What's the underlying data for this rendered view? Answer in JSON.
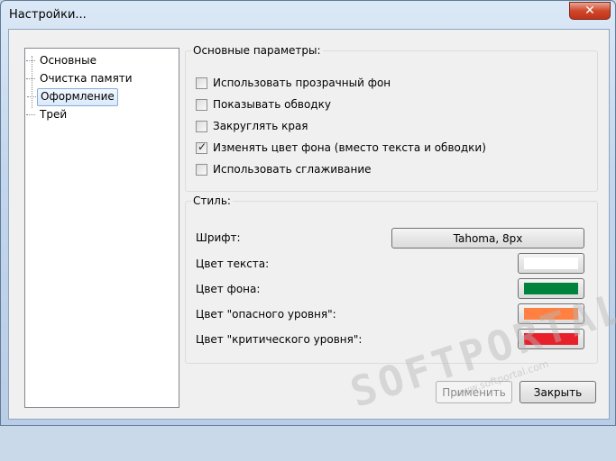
{
  "window": {
    "title": "Настройки...",
    "close_glyph": "✕"
  },
  "tree": {
    "items": [
      {
        "label": "Основные",
        "selected": false
      },
      {
        "label": "Очистка памяти",
        "selected": false
      },
      {
        "label": "Оформление",
        "selected": true
      },
      {
        "label": "Трей",
        "selected": false
      }
    ]
  },
  "main_params": {
    "legend": "Основные параметры:",
    "options": [
      {
        "label": "Использовать прозрачный фон",
        "checked": false
      },
      {
        "label": "Показывать обводку",
        "checked": false
      },
      {
        "label": "Закруглять края",
        "checked": false
      },
      {
        "label": "Изменять цвет фона (вместо текста и обводки)",
        "checked": true
      },
      {
        "label": "Использовать сглаживание",
        "checked": false
      }
    ]
  },
  "style": {
    "legend": "Стиль:",
    "font_label": "Шрифт:",
    "font_value": "Tahoma, 8px",
    "text_color_label": "Цвет текста:",
    "text_color": "#ffffff",
    "bg_color_label": "Цвет фона:",
    "bg_color": "#00843d",
    "danger_label": "Цвет \"опасного уровня\":",
    "danger_color": "#ff8040",
    "critical_label": "Цвет \"критического уровня\":",
    "critical_color": "#e8202a"
  },
  "buttons": {
    "apply": "Применить",
    "close": "Закрыть"
  },
  "watermark": {
    "text": "SOFTPORTAL",
    "sub": "www.softportal.com"
  }
}
